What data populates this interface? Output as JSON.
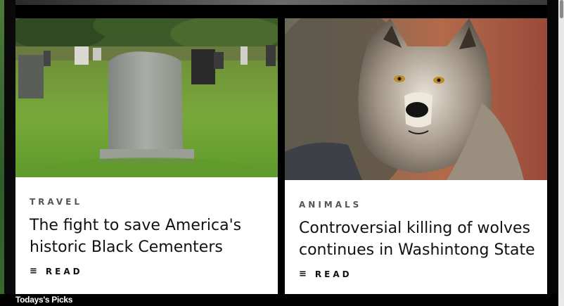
{
  "articles": [
    {
      "category": "TRAVEL",
      "title": "The fight to save America's historic Black Cementers",
      "read_label": "READ",
      "read_icon": "list-icon",
      "image": "cemetery-headstone-photo"
    },
    {
      "category": "ANIMALS",
      "title": "Controversial killing of wolves continues in Washintong State",
      "read_label": "READ",
      "read_icon": "list-icon",
      "image": "gray-wolf-photo"
    }
  ],
  "section": {
    "label": "Todays's Picks"
  },
  "colors": {
    "card_bg": "#ffffff",
    "page_bg": "#000000",
    "category_text": "#555555",
    "headline_text": "#111111"
  }
}
